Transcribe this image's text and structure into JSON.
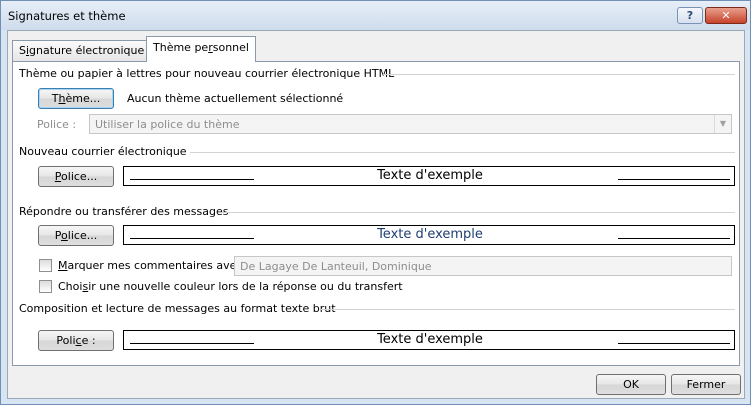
{
  "window": {
    "title": "Signatures et thème",
    "help_label": "?",
    "close_label": "✕"
  },
  "tabs": {
    "signature": {
      "pre": "S",
      "ul": "i",
      "post": "gnature électronique"
    },
    "theme": {
      "pre": "Thème pe",
      "ul": "r",
      "post": "sonnel"
    }
  },
  "theme_section": {
    "title": "Thème ou papier à lettres pour nouveau courrier électronique HTML",
    "theme_button": {
      "pre": "T",
      "ul": "h",
      "post": "ème..."
    },
    "no_theme_text": "Aucun thème actuellement sélectionné",
    "font_label": "Police :",
    "font_value": "Utiliser la police du thème"
  },
  "new_mail": {
    "title": "Nouveau courrier électronique",
    "font_button": {
      "pre": "",
      "ul": "P",
      "post": "olice..."
    },
    "sample_text": "Texte d'exemple",
    "sample_color": "#000000"
  },
  "reply": {
    "title": "Répondre ou transférer des messages",
    "font_button": {
      "pre": "P",
      "ul": "o",
      "post": "lice..."
    },
    "sample_text": "Texte d'exemple",
    "sample_color": "#1f3f73",
    "mark_comments": {
      "pre": "",
      "ul": "M",
      "post": "arquer mes commentaires avec :"
    },
    "mark_comments_value": "De Lagaye De Lanteuil, Dominique",
    "new_color": {
      "pre": "Choi",
      "ul": "s",
      "post": "ir une nouvelle couleur lors de la réponse ou du transfert"
    }
  },
  "plain_text": {
    "title": "Composition et lecture de messages au format texte brut",
    "font_button": {
      "pre": "Poli",
      "ul": "c",
      "post": "e :"
    },
    "sample_text": "Texte d'exemple",
    "sample_color": "#000000"
  },
  "footer": {
    "ok_label": "OK",
    "cancel_label": "Fermer"
  }
}
